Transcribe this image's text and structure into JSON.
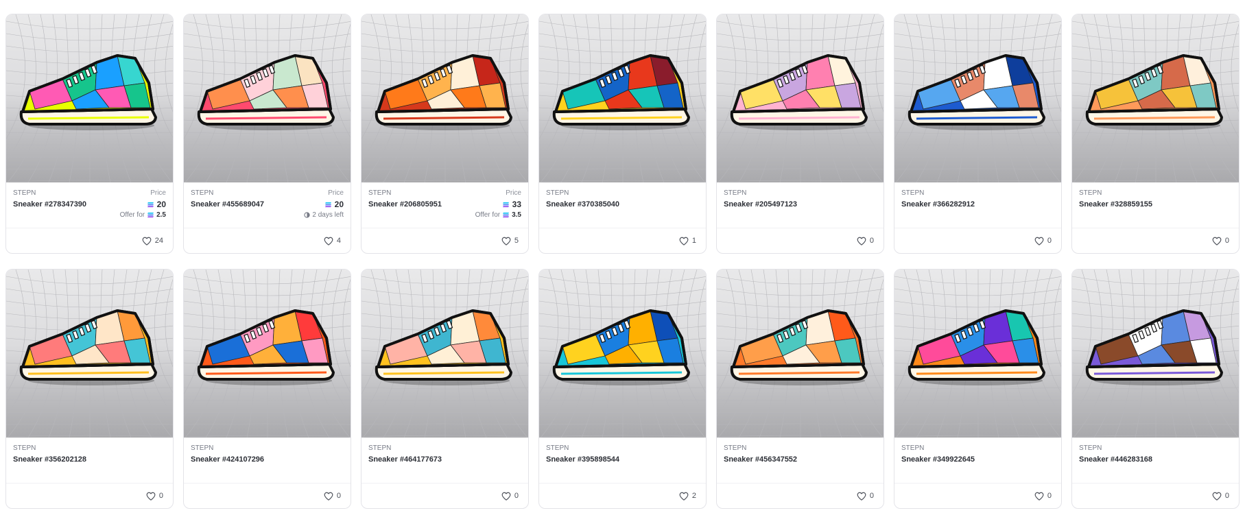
{
  "ui": {
    "price_label": "Price",
    "offer_prefix": "Offer for"
  },
  "icons": {
    "currency": "solana-icon",
    "like": "heart-icon",
    "time": "clock-icon"
  },
  "cards": [
    {
      "brand": "STEPN",
      "name": "Sneaker #278347390",
      "price": "20",
      "offer": "2.5",
      "likes": "24",
      "colors": [
        "#e9ff00",
        "#ff5ab4",
        "#16c58c",
        "#1aa0ff",
        "#37d6d0"
      ]
    },
    {
      "brand": "STEPN",
      "name": "Sneaker #455689047",
      "price": "20",
      "time_left": "2 days left",
      "likes": "4",
      "colors": [
        "#ff4a6e",
        "#ff8f4d",
        "#ffd1d9",
        "#c9e8cf",
        "#fbe3c1"
      ]
    },
    {
      "brand": "STEPN",
      "name": "Sneaker #206805951",
      "price": "33",
      "offer": "3.5",
      "likes": "5",
      "colors": [
        "#d6391c",
        "#ff7a1a",
        "#ffb34d",
        "#fff0d8",
        "#c6261a"
      ]
    },
    {
      "brand": "STEPN",
      "name": "Sneaker #370385040",
      "likes": "1",
      "colors": [
        "#ffd21f",
        "#16c5b8",
        "#1464c8",
        "#e8381c",
        "#8a1c2c"
      ]
    },
    {
      "brand": "STEPN",
      "name": "Sneaker #205497123",
      "likes": "0",
      "colors": [
        "#ffb3d1",
        "#ffe066",
        "#c9a6e0",
        "#ff80b0",
        "#fff3dd"
      ]
    },
    {
      "brand": "STEPN",
      "name": "Sneaker #366282912",
      "likes": "0",
      "colors": [
        "#1d5bd0",
        "#56a7f0",
        "#e8896a",
        "#ffffff",
        "#0e3e9c"
      ]
    },
    {
      "brand": "STEPN",
      "name": "Sneaker #328859155",
      "likes": "0",
      "colors": [
        "#ff9a5a",
        "#f6c23a",
        "#7ec9c4",
        "#d66a4a",
        "#fff0dc"
      ]
    },
    {
      "brand": "STEPN",
      "name": "Sneaker #356202128",
      "likes": "0",
      "colors": [
        "#ffbf1f",
        "#ff7b7b",
        "#44c5d6",
        "#ffe6c8",
        "#ff9a3a"
      ]
    },
    {
      "brand": "STEPN",
      "name": "Sneaker #424107296",
      "likes": "0",
      "colors": [
        "#ff5a1a",
        "#1a6fd8",
        "#ff9ac2",
        "#ffb03a",
        "#ff3b3b"
      ]
    },
    {
      "brand": "STEPN",
      "name": "Sneaker #464177673",
      "likes": "0",
      "colors": [
        "#ffc21f",
        "#ffb3a6",
        "#3fb6d0",
        "#fff0d6",
        "#ff8a3a"
      ]
    },
    {
      "brand": "STEPN",
      "name": "Sneaker #395898544",
      "likes": "2",
      "colors": [
        "#18c6d8",
        "#ffd21f",
        "#1a7fe0",
        "#ffb000",
        "#0e4fb8"
      ]
    },
    {
      "brand": "STEPN",
      "name": "Sneaker #456347552",
      "likes": "0",
      "colors": [
        "#ff7a2a",
        "#ff9e4a",
        "#4cc8c0",
        "#fff0dc",
        "#ff5a1a"
      ]
    },
    {
      "brand": "STEPN",
      "name": "Sneaker #349922645",
      "likes": "0",
      "colors": [
        "#ff8a1a",
        "#ff4b9a",
        "#2a8fe8",
        "#6a2fd8",
        "#18c6b0"
      ]
    },
    {
      "brand": "STEPN",
      "name": "Sneaker #446283168",
      "likes": "0",
      "colors": [
        "#7a5ad8",
        "#8a4a2a",
        "#ffffff",
        "#5a8ae0",
        "#c69ae0"
      ]
    }
  ]
}
